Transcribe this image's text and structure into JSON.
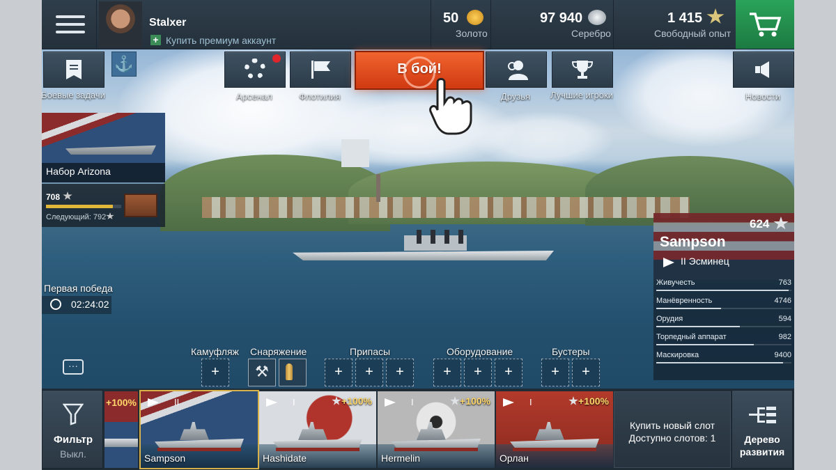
{
  "player": {
    "name": "Stalxer",
    "premium_link": "Купить премиум аккаунт"
  },
  "currency": {
    "gold": {
      "value": "50",
      "label": "Золото"
    },
    "silver": {
      "value": "97 940",
      "label": "Серебро"
    },
    "free_xp": {
      "value": "1 415",
      "label": "Свободный опыт"
    }
  },
  "actions": {
    "missions": "Боевые задачи",
    "arsenal": "Арсенал",
    "flotilla": "Флотилия",
    "battle": "В бой!",
    "friends": "Друзья",
    "top_players": "Лучшие игроки",
    "news": "Новости"
  },
  "promo": {
    "title": "Набор Arizona"
  },
  "progress": {
    "value": "708",
    "next": "Следующий: 792",
    "fraction": 0.89
  },
  "first_win": {
    "label": "Первая победа",
    "timer": "02:24:02"
  },
  "ship": {
    "name": "Sampson",
    "xp": "624",
    "tier_class": "II Эсминец",
    "stats": [
      {
        "name": "Живучесть",
        "value": "763",
        "fraction": 0.98
      },
      {
        "name": "Манёвренность",
        "value": "4746",
        "fraction": 0.48
      },
      {
        "name": "Орудия",
        "value": "594",
        "fraction": 0.62
      },
      {
        "name": "Торпедный аппарат",
        "value": "982",
        "fraction": 0.72
      },
      {
        "name": "Маскировка",
        "value": "9400",
        "fraction": 0.94
      }
    ]
  },
  "equipment": {
    "camo": "Камуфляж",
    "gear": "Снаряжение",
    "ammo": "Припасы",
    "modules": "Оборудование",
    "boosters": "Бустеры",
    "slot_plus": "+"
  },
  "bottom": {
    "filter_label": "Фильтр",
    "filter_state": "Выкл.",
    "tree_label_1": "Дерево",
    "tree_label_2": "развития",
    "buy_slot_1": "Купить новый слот",
    "buy_slot_2": "Доступно слотов: 1",
    "partial_bonus": "+100%"
  },
  "carousel": [
    {
      "name": "Sampson",
      "tier": "II",
      "bonus": ""
    },
    {
      "name": "Hashidate",
      "tier": "I",
      "bonus": "+100%"
    },
    {
      "name": "Hermelin",
      "tier": "I",
      "bonus": "+100%"
    },
    {
      "name": "Орлан",
      "tier": "I",
      "bonus": "+100%"
    }
  ],
  "icons": [
    "menu-icon",
    "anchor-icon",
    "gear-icon",
    "flag-icon",
    "friends-icon",
    "trophy-icon",
    "megaphone-icon",
    "cart-icon",
    "filter-icon",
    "tree-icon",
    "chat-icon",
    "timer-icon",
    "pointer-hand-icon",
    "star-icon",
    "gold-coins-icon",
    "silver-coins-icon",
    "premium-plus-icon"
  ],
  "colors": {
    "battle": "#e2481e",
    "cart": "#1e8a4a",
    "accent_gold": "#ffd76a"
  }
}
